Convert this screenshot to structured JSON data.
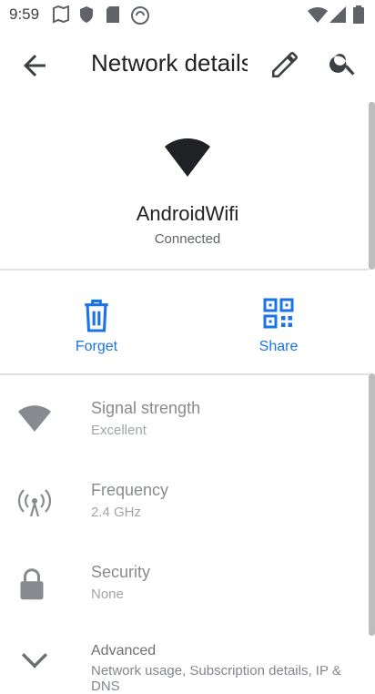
{
  "status_bar": {
    "time": "9:59"
  },
  "app_bar": {
    "title": "Network details"
  },
  "network": {
    "name": "AndroidWifi",
    "status": "Connected"
  },
  "actions": [
    {
      "label": "Forget"
    },
    {
      "label": "Share"
    }
  ],
  "details": [
    {
      "title": "Signal strength",
      "value": "Excellent"
    },
    {
      "title": "Frequency",
      "value": "2.4 GHz"
    },
    {
      "title": "Security",
      "value": "None"
    },
    {
      "title": "Advanced",
      "value": "Network usage, Subscription details, IP & DNS"
    }
  ],
  "colors": {
    "accent": "#1a73e8",
    "icon": "#5f6368",
    "text": "#202124"
  }
}
